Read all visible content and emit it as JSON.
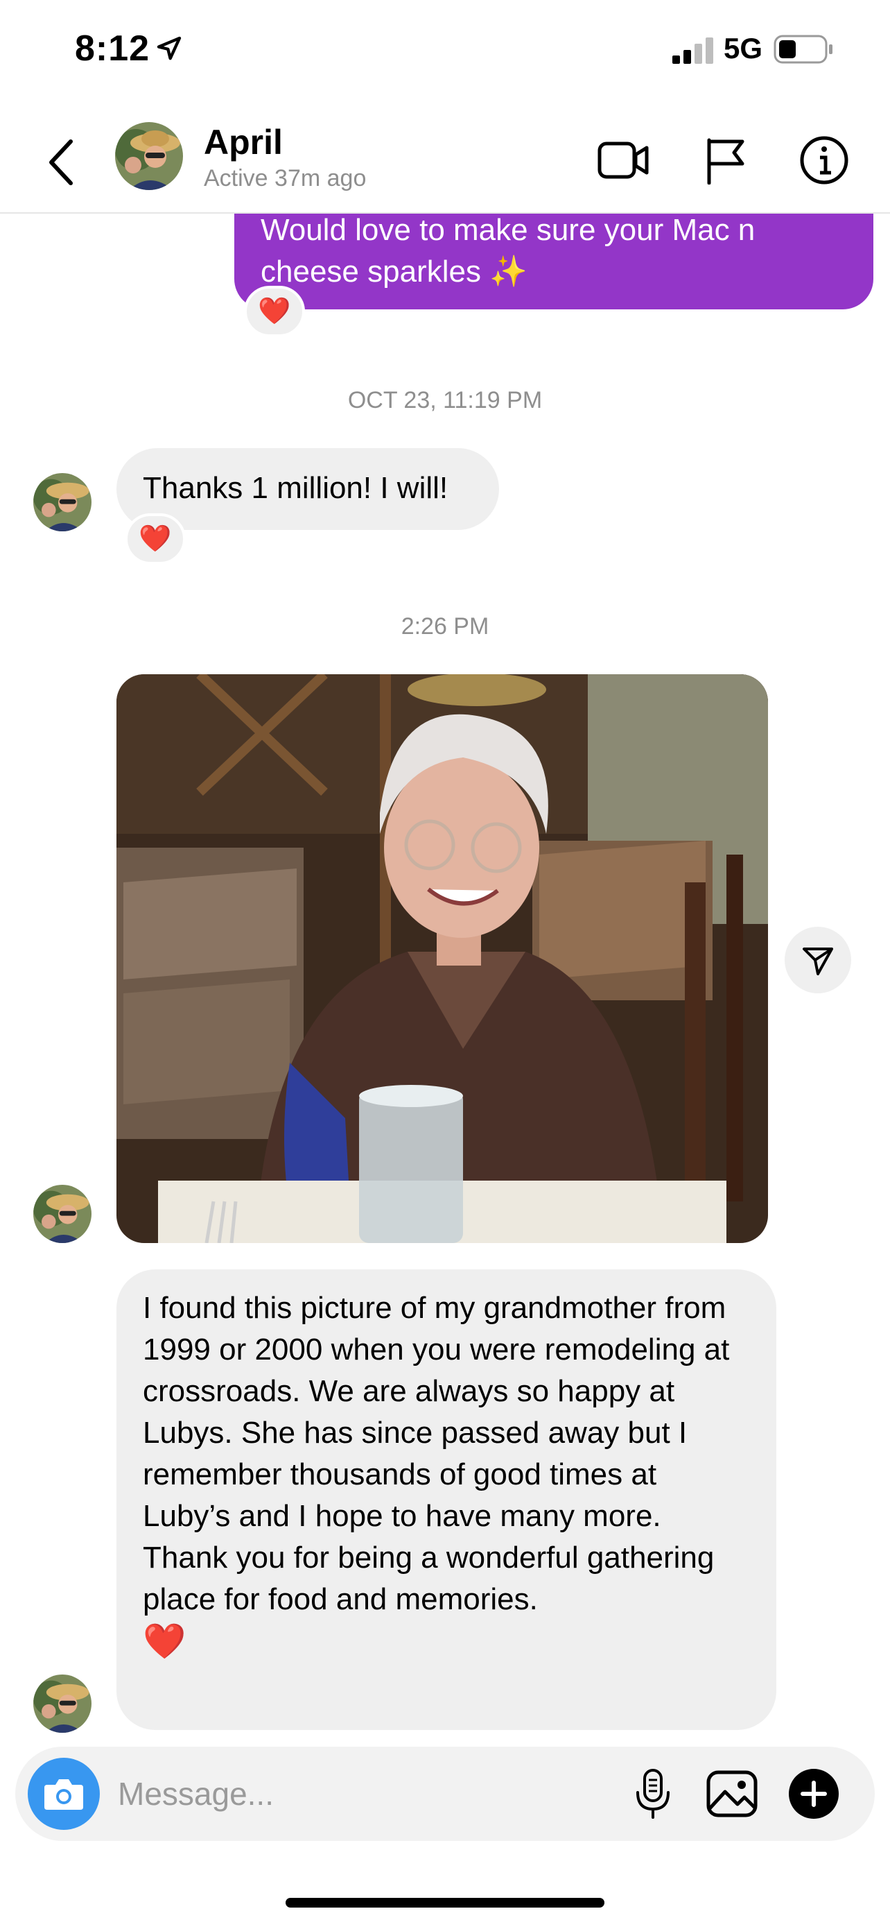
{
  "status_bar": {
    "time": "8:12",
    "network": "5G",
    "icons": [
      "location-arrow-icon",
      "signal-icon",
      "battery-icon"
    ]
  },
  "header": {
    "contact_name": "April",
    "contact_status": "Active 37m ago",
    "icons": [
      "back-chevron-icon",
      "video-call-icon",
      "flag-icon",
      "info-icon"
    ]
  },
  "thread": {
    "outgoing_message": {
      "line1": "Would love to make sure your Mac n",
      "line2": "cheese sparkles ✨",
      "reaction": "❤️"
    },
    "timestamp_1": "OCT 23, 11:19 PM",
    "incoming_message_1": {
      "text": "Thanks 1 million! I will!",
      "reaction": "❤️"
    },
    "timestamp_2": "2:26 PM",
    "photo": {
      "description_icon": "shared-photo"
    },
    "incoming_message_2": {
      "paragraph1": "I found this picture of my grandmother from 1999 or 2000 when you were remodeling at crossroads. We are always so happy at Lubys. She has since passed away but I remember thousands of good times at Luby’s and I hope to have many more.",
      "paragraph2": "Thank you for being a wonderful gathering place for food and memories.",
      "emoji": "❤️"
    }
  },
  "composer": {
    "placeholder": "Message...",
    "icons": [
      "camera-icon",
      "microphone-icon",
      "gallery-icon",
      "plus-icon"
    ]
  },
  "colors": {
    "outgoing_bubble": "#9336c8",
    "incoming_bubble": "#efefef",
    "camera_button": "#3897f0",
    "timestamp": "#8e8e8e"
  }
}
